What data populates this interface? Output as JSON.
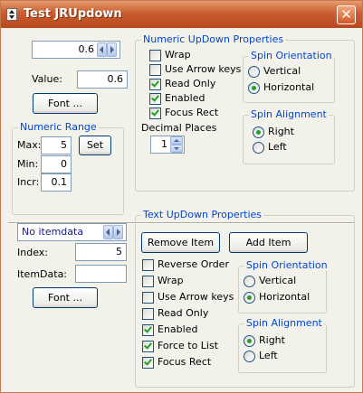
{
  "window": {
    "title": "Test JRUpdown",
    "close_glyph": "✕"
  },
  "numeric": {
    "display_value": "0.6",
    "value_label": "Value:",
    "value": "0.6",
    "font_button": "Font ...",
    "range": {
      "title": "Numeric Range",
      "max_label": "Max:",
      "max": "5",
      "min_label": "Min:",
      "min": "0",
      "incr_label": "Incr:",
      "incr": "0.1",
      "set_button": "Set"
    },
    "props": {
      "title": "Numeric UpDown Properties",
      "wrap": {
        "label": "Wrap",
        "checked": false
      },
      "arrow_keys": {
        "label": "Use Arrow keys",
        "checked": false
      },
      "read_only": {
        "label": "Read Only",
        "checked": true
      },
      "enabled": {
        "label": "Enabled",
        "checked": true
      },
      "focus_rect": {
        "label": "Focus Rect",
        "checked": true
      },
      "decimal_places_label": "Decimal Places",
      "decimal_places": "1",
      "orientation": {
        "title": "Spin Orientation",
        "vertical": {
          "label": "Vertical",
          "selected": false
        },
        "horizontal": {
          "label": "Horizontal",
          "selected": true
        }
      },
      "alignment": {
        "title": "Spin Alignment",
        "right": {
          "label": "Right",
          "selected": true
        },
        "left": {
          "label": "Left",
          "selected": false
        }
      }
    }
  },
  "text": {
    "display_value": "No itemdata",
    "index_label": "Index:",
    "index": "5",
    "itemdata_label": "ItemData:",
    "itemdata": "",
    "font_button": "Font ...",
    "props": {
      "title": "Text UpDown Properties",
      "remove_button": "Remove Item",
      "add_button": "Add Item",
      "reverse_order": {
        "label": "Reverse Order",
        "checked": false
      },
      "wrap": {
        "label": "Wrap",
        "checked": false
      },
      "arrow_keys": {
        "label": "Use Arrow keys",
        "checked": false
      },
      "read_only": {
        "label": "Read Only",
        "checked": false
      },
      "enabled": {
        "label": "Enabled",
        "checked": true
      },
      "force_to_list": {
        "label": "Force to List",
        "checked": true
      },
      "focus_rect": {
        "label": "Focus Rect",
        "checked": true
      },
      "orientation": {
        "title": "Spin Orientation",
        "vertical": {
          "label": "Vertical",
          "selected": false
        },
        "horizontal": {
          "label": "Horizontal",
          "selected": true
        }
      },
      "alignment": {
        "title": "Spin Alignment",
        "right": {
          "label": "Right",
          "selected": true
        },
        "left": {
          "label": "Left",
          "selected": false
        }
      }
    }
  },
  "colors": {
    "titlebar": "#c95d2e",
    "group_title": "#0046d5",
    "check": "#21a121",
    "text_field_value": "#1a1a8c"
  }
}
